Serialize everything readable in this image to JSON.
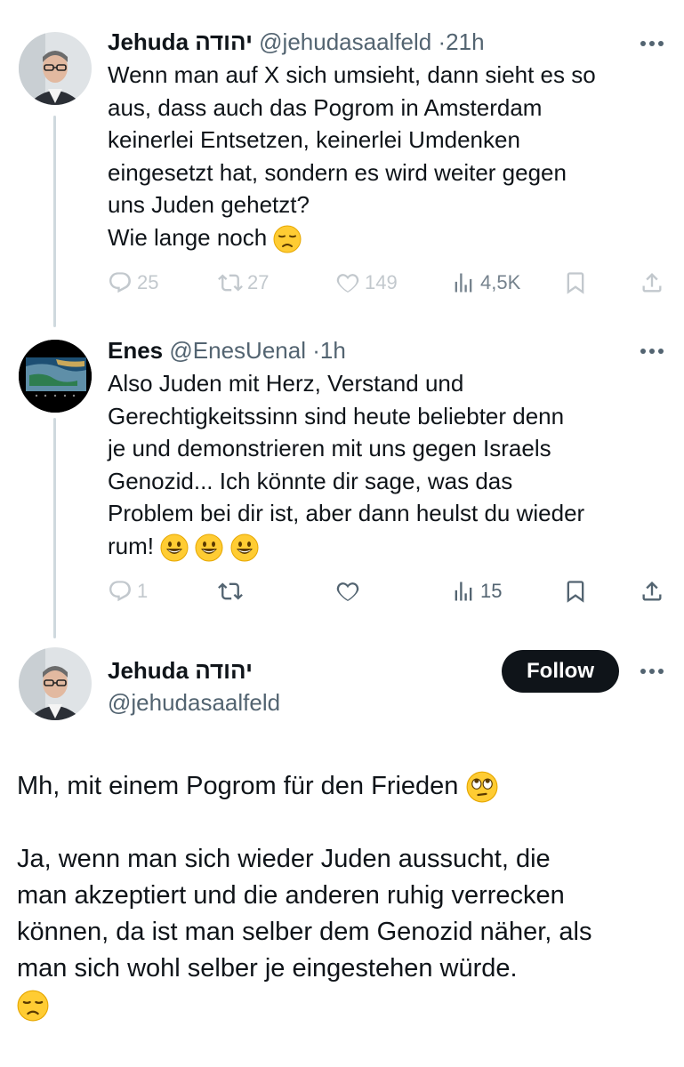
{
  "tweets": [
    {
      "name": "Jehuda יהודה",
      "handle": "@jehudasaalfeld",
      "time": "21h",
      "text_lines": [
        "Wenn man auf X sich umsieht, dann sieht es so",
        "aus, dass auch das Pogrom in Amsterdam",
        "keinerlei Entsetzen, keinerlei Umdenken",
        "eingesetzt hat, sondern es wird weiter gegen",
        "uns Juden gehetzt?",
        "Wie lange noch"
      ],
      "trailing_emoji": "disappointed-face",
      "replies": "25",
      "reposts": "27",
      "likes": "149",
      "views": "4,5K"
    },
    {
      "name": "Enes",
      "handle": "@EnesUenal",
      "time": "1h",
      "text_lines": [
        "Also Juden mit Herz, Verstand und",
        "Gerechtigkeitssinn sind heute beliebter denn",
        "je und demonstrieren mit uns gegen Israels",
        "Genozid... Ich könnte dir sage, was das",
        "Problem bei dir ist, aber dann heulst du wieder",
        "rum!"
      ],
      "trailing_emoji": "grinning-face x3",
      "replies": "1",
      "views": "15"
    }
  ],
  "main_tweet": {
    "name": "Jehuda יהודה",
    "handle": "@jehudasaalfeld",
    "follow_label": "Follow",
    "paragraph1": "Mh, mit einem Pogrom für den Frieden",
    "paragraph1_emoji": "face-with-rolling-eyes",
    "paragraph2_lines": [
      "Ja, wenn man sich wieder Juden aussucht, die",
      "man akzeptiert und die anderen ruhig verrecken",
      "können, da ist man selber dem Genozid näher, als",
      "man sich wohl selber je eingestehen würde."
    ],
    "paragraph2_emoji": "disappointed-face"
  },
  "colors": {
    "text": "#0f1419",
    "secondary": "#536471",
    "thread_line": "#cfd9de",
    "follow_bg": "#0f1419"
  }
}
